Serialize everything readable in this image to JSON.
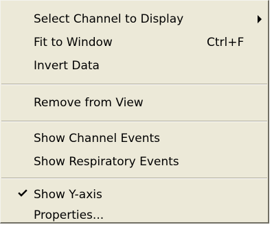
{
  "menu": {
    "items": [
      {
        "label": "Select Channel to Display",
        "submenu": true
      },
      {
        "label": "Fit to Window",
        "shortcut": "Ctrl+F"
      },
      {
        "label": "Invert Data"
      },
      {
        "label": "Remove from View"
      },
      {
        "label": "Show Channel Events"
      },
      {
        "label": "Show Respiratory Events"
      },
      {
        "label": "Show Y-axis",
        "checked": true,
        "check_icon": "checkmark-icon"
      },
      {
        "label": "Properties..."
      }
    ]
  },
  "colors": {
    "menu_background": "#ece9d8",
    "text": "#000000",
    "separator_dark": "#aca899",
    "separator_light": "#ffffff"
  }
}
